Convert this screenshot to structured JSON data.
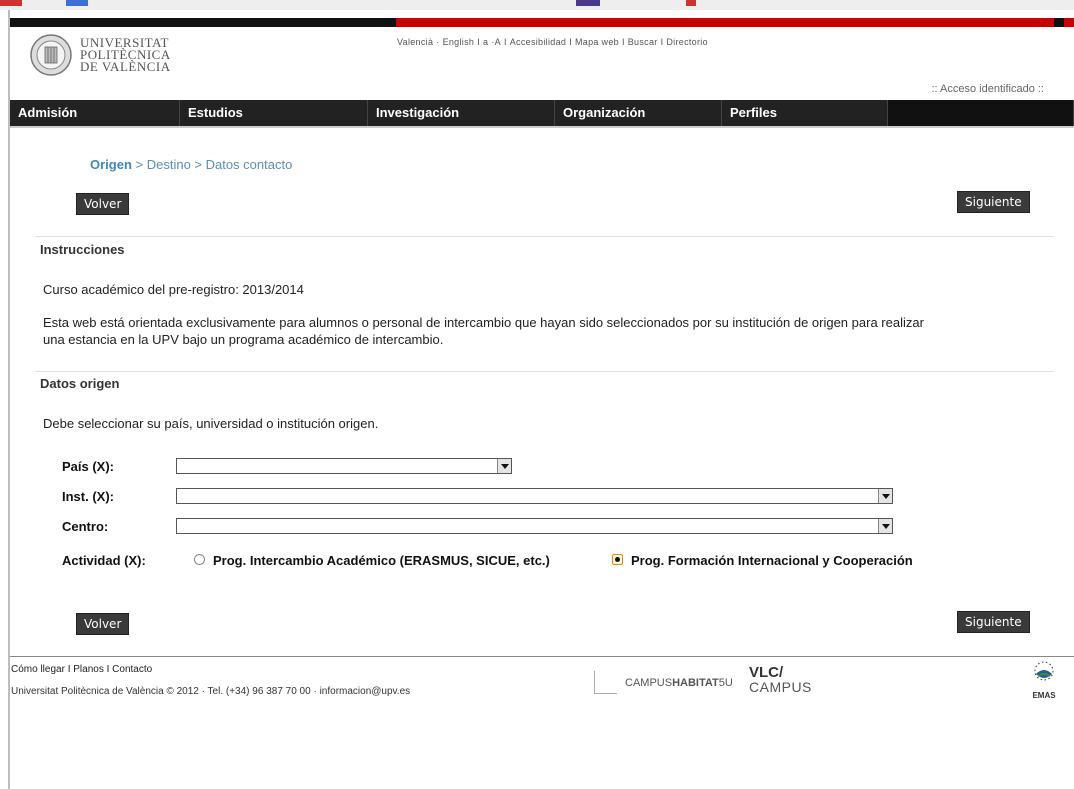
{
  "header": {
    "logo_lines": [
      "UNIVERSITAT",
      "POLITÈCNICA",
      "DE VALÈNCIA"
    ],
    "top_links": [
      "Valencià",
      "·",
      "English",
      "I",
      "a",
      "·A",
      "I",
      "Accesibilidad",
      "I",
      "Mapa web",
      "I",
      "Buscar",
      "I",
      "Directorio"
    ],
    "access_link": ":: Acceso identificado ::"
  },
  "nav": {
    "items": [
      "Admisión",
      "Estudios",
      "Investigación",
      "Organización",
      "Perfiles"
    ]
  },
  "breadcrumb": {
    "current": "Origen",
    "rest": " > Destino > Datos contacto"
  },
  "buttons": {
    "back": "Volver",
    "next": "Siguiente"
  },
  "instructions": {
    "title": "Instrucciones",
    "course": "Curso académico del pre-registro: 2013/2014",
    "text_line1": "Esta web está orientada exclusivamente para alumnos o personal de intercambio que hayan sido seleccionados por su institución de origen para realizar",
    "text_line2": "una estancia en la UPV bajo un programa académico de intercambio."
  },
  "origin": {
    "title": "Datos origen",
    "hint": "Debe seleccionar su país, universidad o institución origen.",
    "country_label": "País (X):",
    "country_value": "",
    "institution_label": "Inst. (X):",
    "institution_value": "",
    "center_label": "Centro:",
    "center_value": "",
    "activity_label": "Actividad (X):",
    "activity_options": [
      {
        "label": "Prog. Intercambio Académico (ERASMUS, SICUE, etc.)",
        "checked": false
      },
      {
        "label": "Prog. Formación Internacional y Cooperación",
        "checked": true
      }
    ]
  },
  "footer": {
    "links": "Cómo llegar I Planos I Contacto",
    "copyright": "Universitat Politècnica de València © 2012 · Tel. (+34) 96 387 70 00 · informacion@upv.es",
    "campus_a": "CAMPUS",
    "campus_b": "HABITAT",
    "campus_c": "5U",
    "vlc_1": "VLC/",
    "vlc_2": "CAMPUS",
    "emas": "EMAS"
  }
}
